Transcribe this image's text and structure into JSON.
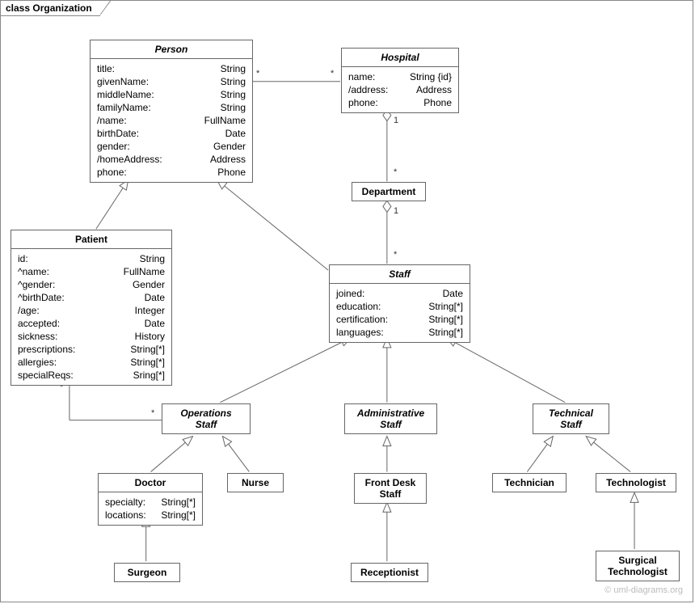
{
  "frame": {
    "title": "class Organization"
  },
  "classes": {
    "person": {
      "name": "Person",
      "attrs": [
        {
          "n": "title:",
          "t": "String"
        },
        {
          "n": "givenName:",
          "t": "String"
        },
        {
          "n": "middleName:",
          "t": "String"
        },
        {
          "n": "familyName:",
          "t": "String"
        },
        {
          "n": "/name:",
          "t": "FullName"
        },
        {
          "n": "birthDate:",
          "t": "Date"
        },
        {
          "n": "gender:",
          "t": "Gender"
        },
        {
          "n": "/homeAddress:",
          "t": "Address"
        },
        {
          "n": "phone:",
          "t": "Phone"
        }
      ]
    },
    "hospital": {
      "name": "Hospital",
      "attrs": [
        {
          "n": "name:",
          "t": "String {id}"
        },
        {
          "n": "/address:",
          "t": "Address"
        },
        {
          "n": "phone:",
          "t": "Phone"
        }
      ]
    },
    "department": {
      "name": "Department"
    },
    "patient": {
      "name": "Patient",
      "attrs": [
        {
          "n": "id:",
          "t": "String"
        },
        {
          "n": "^name:",
          "t": "FullName"
        },
        {
          "n": "^gender:",
          "t": "Gender"
        },
        {
          "n": "^birthDate:",
          "t": "Date"
        },
        {
          "n": "/age:",
          "t": "Integer"
        },
        {
          "n": "accepted:",
          "t": "Date"
        },
        {
          "n": "sickness:",
          "t": "History"
        },
        {
          "n": "prescriptions:",
          "t": "String[*]"
        },
        {
          "n": "allergies:",
          "t": "String[*]"
        },
        {
          "n": "specialReqs:",
          "t": "Sring[*]"
        }
      ]
    },
    "staff": {
      "name": "Staff",
      "attrs": [
        {
          "n": "joined:",
          "t": "Date"
        },
        {
          "n": "education:",
          "t": "String[*]"
        },
        {
          "n": "certification:",
          "t": "String[*]"
        },
        {
          "n": "languages:",
          "t": "String[*]"
        }
      ]
    },
    "opsStaff": {
      "name": "Operations\nStaff"
    },
    "adminStaff": {
      "name": "Administrative\nStaff"
    },
    "techStaff": {
      "name": "Technical\nStaff"
    },
    "doctor": {
      "name": "Doctor",
      "attrs": [
        {
          "n": "specialty:",
          "t": "String[*]"
        },
        {
          "n": "locations:",
          "t": "String[*]"
        }
      ]
    },
    "nurse": {
      "name": "Nurse"
    },
    "frontDesk": {
      "name": "Front Desk\nStaff"
    },
    "technician": {
      "name": "Technician"
    },
    "technologist": {
      "name": "Technologist"
    },
    "surgeon": {
      "name": "Surgeon"
    },
    "receptionist": {
      "name": "Receptionist"
    },
    "surgTech": {
      "name": "Surgical\nTechnologist"
    }
  },
  "mult": {
    "personHospital_a": "*",
    "personHospital_b": "*",
    "hospDept_1": "1",
    "hospDept_star": "*",
    "deptStaff_1": "1",
    "deptStaff_star": "*",
    "patientOps_a": "*",
    "patientOps_b": "*"
  },
  "watermark": "© uml-diagrams.org"
}
